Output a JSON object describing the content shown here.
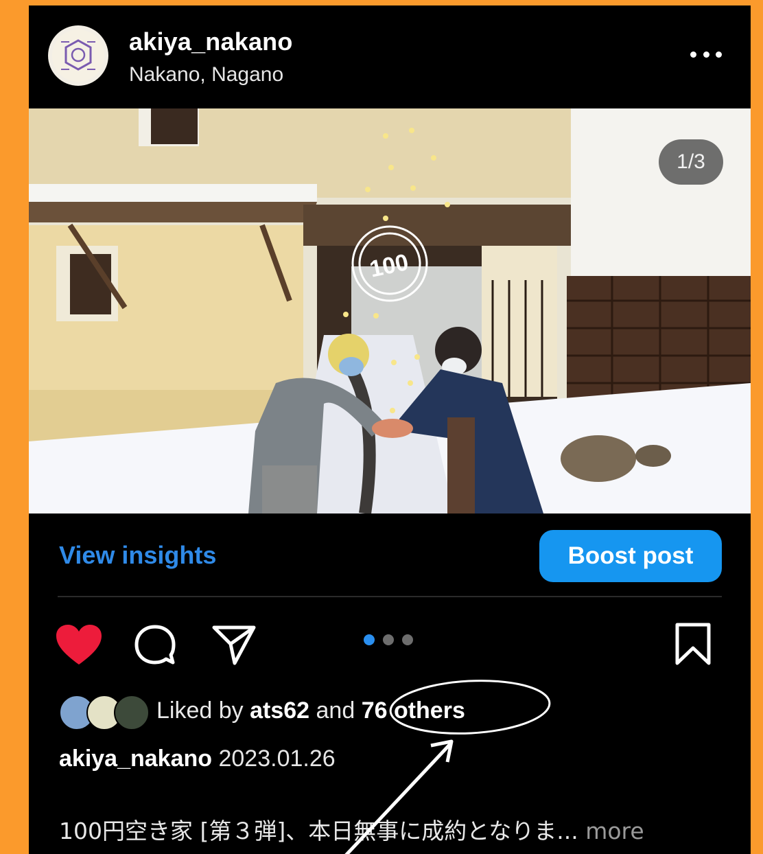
{
  "post": {
    "username": "akiya_nakano",
    "location": "Nakano, Nagano",
    "page_indicator": "1/3",
    "carousel_total": 3,
    "carousel_active": 1
  },
  "actions": {
    "insights_label": "View insights",
    "boost_label": "Boost post"
  },
  "likes": {
    "prefix": "Liked by ",
    "user": "ats62",
    "and": " and ",
    "others": "76 others"
  },
  "caption": {
    "username": "akiya_nakano",
    "date": "2023.01.26",
    "text": "100円空き家 [第３弾]、本日無事に成約となりま...",
    "more": " more"
  },
  "colors": {
    "frame": "#fb9a2c",
    "background": "#000000",
    "accent_link": "#2f8ae8",
    "boost_button": "#1696f0",
    "heart": "#ed1c3b"
  },
  "icons": {
    "more": "more-horizontal-icon",
    "like": "heart-filled-icon",
    "comment": "comment-bubble-icon",
    "share": "paper-plane-icon",
    "save": "bookmark-icon"
  }
}
